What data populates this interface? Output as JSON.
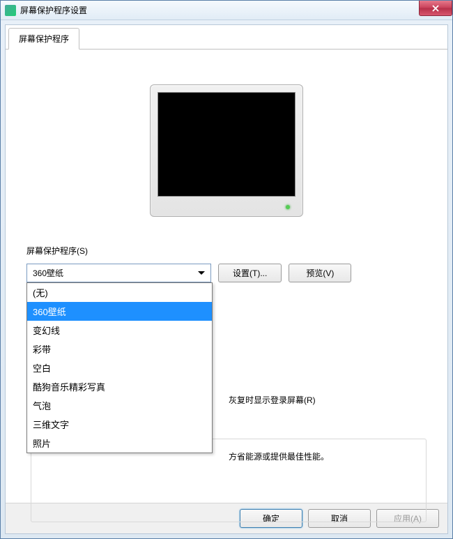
{
  "window": {
    "title": "屏幕保护程序设置"
  },
  "tab": {
    "label": "屏幕保护程序"
  },
  "section": {
    "label": "屏幕保护程序(S)"
  },
  "dropdown": {
    "selected": "360壁纸",
    "options": [
      "(无)",
      "360壁纸",
      "变幻线",
      "彩带",
      "空白",
      "酷狗音乐精彩写真",
      "气泡",
      "三维文字",
      "照片"
    ]
  },
  "buttons": {
    "settings": "设置(T)...",
    "preview": "预览(V)",
    "ok": "确定",
    "cancel": "取消",
    "apply": "应用(A)"
  },
  "partial": {
    "resume_text": "灰复时显示登录屏幕(R)",
    "power_text": "方省能源或提供最佳性能。"
  }
}
